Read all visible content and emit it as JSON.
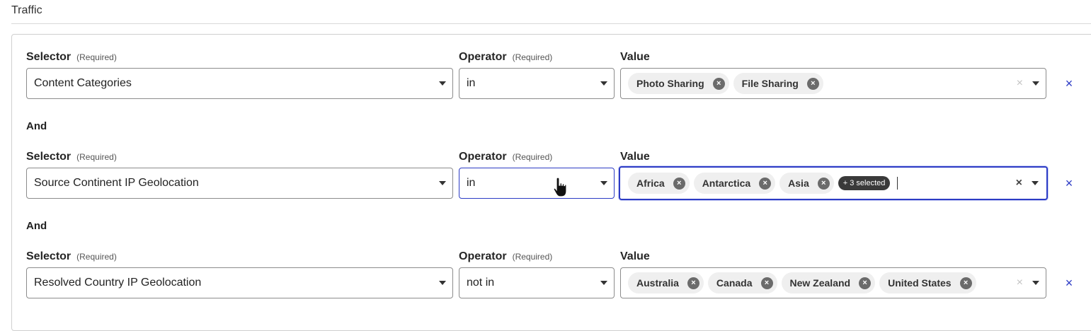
{
  "section": {
    "title": "Traffic"
  },
  "labels": {
    "selector": "Selector",
    "operator": "Operator",
    "value": "Value",
    "required": "(Required)",
    "and": "And"
  },
  "rows": [
    {
      "selector": "Content Categories",
      "operator": "in",
      "values": [
        "Photo Sharing",
        "File Sharing"
      ],
      "more": ""
    },
    {
      "selector": "Source Continent IP Geolocation",
      "operator": "in",
      "values": [
        "Africa",
        "Antarctica",
        "Asia"
      ],
      "more": "+ 3 selected"
    },
    {
      "selector": "Resolved Country IP Geolocation",
      "operator": "not in",
      "values": [
        "Australia",
        "Canada",
        "New Zealand",
        "United States"
      ],
      "more": ""
    }
  ],
  "glyphs": {
    "close": "×",
    "chip_close": "×"
  },
  "colors": {
    "accent": "#2c3bc5",
    "chip_bg": "#efefef",
    "chip_close_bg": "#6b6b6b"
  }
}
